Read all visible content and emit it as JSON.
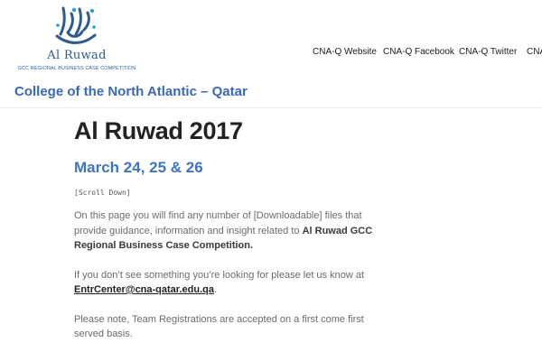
{
  "header": {
    "logo_name": "Al Ruwad",
    "logo_tagline": "GCC REGIONAL BUSINESS CASE COMPETITION",
    "site_title": "College of the North Atlantic – Qatar"
  },
  "nav": {
    "items": [
      {
        "label": "CNA-Q Website"
      },
      {
        "label": "CNA-Q Facebook"
      },
      {
        "label": "CNA-Q Twitter"
      },
      {
        "label": "CNA-Q"
      }
    ]
  },
  "main": {
    "title": "Al Ruwad 2017",
    "dates": "March 24, 25 & 26",
    "scroll_note": "[Scroll Down]",
    "intro_text": "On this page you will find any number of [Downloadable] files that provide guidance, information and insight related to",
    "intro_bold": "Al Ruwad GCC Regional Business Case Competition.",
    "contact_text": "If you don’t see something you’re looking for please let us know at",
    "contact_email": "EntrCenter@cna-qatar.edu.qa",
    "contact_end": ".",
    "note_text": "Please note, Team Registrations are accepted on a first come first served basis."
  },
  "colors": {
    "logo": "#2f5a90",
    "site_title": "#3a68b8",
    "date_heading": "#3e73c6",
    "page_title": "#222222",
    "body_text": "#6b6b6b"
  }
}
